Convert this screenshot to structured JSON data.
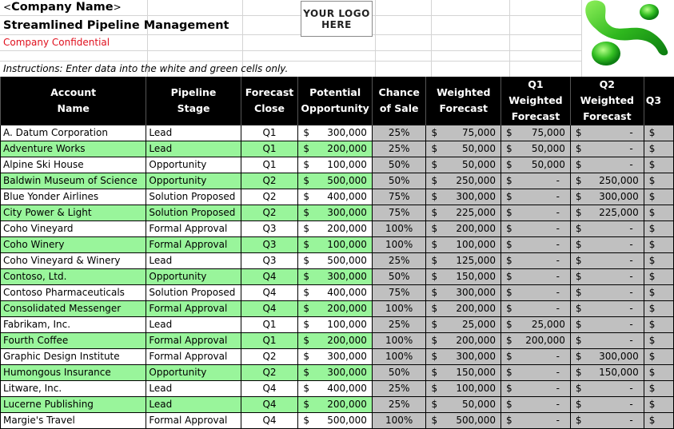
{
  "header": {
    "company_prefix": "<",
    "company_name": "Company Name",
    "company_suffix": ">",
    "title": "Streamlined Pipeline Management",
    "confidential": "Company Confidential",
    "instructions": "Instructions: Enter data into the white and green cells only.",
    "logo_placeholder_line1": "YOUR LOGO",
    "logo_placeholder_line2": "HERE"
  },
  "colors": {
    "header_bg": "#000000",
    "header_text": "#ffffff",
    "input_green": "#99f59b",
    "calc_gray": "#c0c0c0",
    "confidential_red": "#e0101e"
  },
  "table": {
    "columns": [
      {
        "line1": "Account",
        "line2": "Name"
      },
      {
        "line1": "Pipeline",
        "line2": "Stage"
      },
      {
        "line1": "Forecast",
        "line2": "Close"
      },
      {
        "line1": "Potential",
        "line2": "Opportunity"
      },
      {
        "line1": "Chance",
        "line2": "of Sale"
      },
      {
        "line1": "Weighted",
        "line2": "Forecast"
      },
      {
        "line1": "Q1 Weighted",
        "line2": "Forecast"
      },
      {
        "line1": "Q2 Weighted",
        "line2": "Forecast"
      },
      {
        "line1": "Q3",
        "line2": ""
      }
    ],
    "currency_symbol": "$",
    "rows": [
      {
        "account": "A. Datum Corporation",
        "stage": "Lead",
        "close": "Q1",
        "potential": "300,000",
        "chance": "25%",
        "weighted": "75,000",
        "q1": "75,000",
        "q2": "-",
        "q3": ""
      },
      {
        "account": "Adventure Works",
        "stage": "Lead",
        "close": "Q1",
        "potential": "200,000",
        "chance": "25%",
        "weighted": "50,000",
        "q1": "50,000",
        "q2": "-",
        "q3": ""
      },
      {
        "account": "Alpine Ski House",
        "stage": "Opportunity",
        "close": "Q1",
        "potential": "100,000",
        "chance": "50%",
        "weighted": "50,000",
        "q1": "50,000",
        "q2": "-",
        "q3": ""
      },
      {
        "account": "Baldwin Museum of Science",
        "stage": "Opportunity",
        "close": "Q2",
        "potential": "500,000",
        "chance": "50%",
        "weighted": "250,000",
        "q1": "-",
        "q2": "250,000",
        "q3": ""
      },
      {
        "account": "Blue Yonder Airlines",
        "stage": "Solution Proposed",
        "close": "Q2",
        "potential": "400,000",
        "chance": "75%",
        "weighted": "300,000",
        "q1": "-",
        "q2": "300,000",
        "q3": ""
      },
      {
        "account": "City Power & Light",
        "stage": "Solution Proposed",
        "close": "Q2",
        "potential": "300,000",
        "chance": "75%",
        "weighted": "225,000",
        "q1": "-",
        "q2": "225,000",
        "q3": ""
      },
      {
        "account": "Coho Vineyard",
        "stage": "Formal Approval",
        "close": "Q3",
        "potential": "200,000",
        "chance": "100%",
        "weighted": "200,000",
        "q1": "-",
        "q2": "-",
        "q3": ""
      },
      {
        "account": "Coho Winery",
        "stage": "Formal Approval",
        "close": "Q3",
        "potential": "100,000",
        "chance": "100%",
        "weighted": "100,000",
        "q1": "-",
        "q2": "-",
        "q3": ""
      },
      {
        "account": "Coho Vineyard & Winery",
        "stage": "Lead",
        "close": "Q3",
        "potential": "500,000",
        "chance": "25%",
        "weighted": "125,000",
        "q1": "-",
        "q2": "-",
        "q3": ""
      },
      {
        "account": "Contoso, Ltd.",
        "stage": "Opportunity",
        "close": "Q4",
        "potential": "300,000",
        "chance": "50%",
        "weighted": "150,000",
        "q1": "-",
        "q2": "-",
        "q3": ""
      },
      {
        "account": "Contoso Pharmaceuticals",
        "stage": "Solution Proposed",
        "close": "Q4",
        "potential": "400,000",
        "chance": "75%",
        "weighted": "300,000",
        "q1": "-",
        "q2": "-",
        "q3": ""
      },
      {
        "account": "Consolidated Messenger",
        "stage": "Formal Approval",
        "close": "Q4",
        "potential": "200,000",
        "chance": "100%",
        "weighted": "200,000",
        "q1": "-",
        "q2": "-",
        "q3": ""
      },
      {
        "account": "Fabrikam, Inc.",
        "stage": "Lead",
        "close": "Q1",
        "potential": "100,000",
        "chance": "25%",
        "weighted": "25,000",
        "q1": "25,000",
        "q2": "-",
        "q3": ""
      },
      {
        "account": "Fourth Coffee",
        "stage": "Formal Approval",
        "close": "Q1",
        "potential": "200,000",
        "chance": "100%",
        "weighted": "200,000",
        "q1": "200,000",
        "q2": "-",
        "q3": ""
      },
      {
        "account": "Graphic Design Institute",
        "stage": "Formal Approval",
        "close": "Q2",
        "potential": "300,000",
        "chance": "100%",
        "weighted": "300,000",
        "q1": "-",
        "q2": "300,000",
        "q3": ""
      },
      {
        "account": "Humongous Insurance",
        "stage": "Opportunity",
        "close": "Q2",
        "potential": "300,000",
        "chance": "50%",
        "weighted": "150,000",
        "q1": "-",
        "q2": "150,000",
        "q3": ""
      },
      {
        "account": "Litware, Inc.",
        "stage": "Lead",
        "close": "Q4",
        "potential": "400,000",
        "chance": "25%",
        "weighted": "100,000",
        "q1": "-",
        "q2": "-",
        "q3": ""
      },
      {
        "account": "Lucerne Publishing",
        "stage": "Lead",
        "close": "Q4",
        "potential": "200,000",
        "chance": "25%",
        "weighted": "50,000",
        "q1": "-",
        "q2": "-",
        "q3": ""
      },
      {
        "account": "Margie's Travel",
        "stage": "Formal Approval",
        "close": "Q4",
        "potential": "500,000",
        "chance": "100%",
        "weighted": "500,000",
        "q1": "-",
        "q2": "-",
        "q3": ""
      }
    ]
  }
}
